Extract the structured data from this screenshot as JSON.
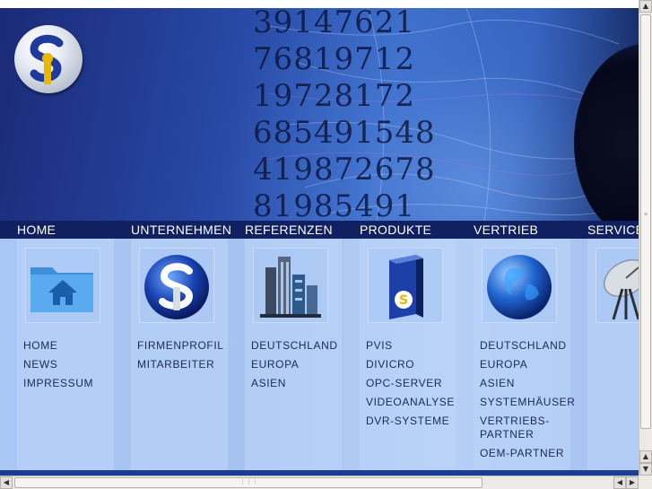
{
  "header": {
    "background_numbers": [
      "39147621",
      "76819712",
      "19728172",
      "685491548",
      "419872678",
      "81985491"
    ],
    "logo_icon": "s-logo-icon"
  },
  "nav": {
    "items": [
      {
        "label": "HOME"
      },
      {
        "label": "UNTERNEHMEN"
      },
      {
        "label": "REFERENZEN"
      },
      {
        "label": "PRODUKTE"
      },
      {
        "label": "VERTRIEB"
      },
      {
        "label": "SERVICE"
      }
    ]
  },
  "columns": [
    {
      "icon": "home-folder-icon",
      "items": [
        "HOME",
        "NEWS",
        "IMPRESSUM"
      ]
    },
    {
      "icon": "s-globe-logo-icon",
      "items": [
        "FIRMENPROFIL",
        "MITARBEITER"
      ]
    },
    {
      "icon": "office-buildings-icon",
      "items": [
        "DEUTSCHLAND",
        "EUROPA",
        "ASIEN"
      ]
    },
    {
      "icon": "software-box-icon",
      "items": [
        "PVIS",
        "DIVICRO",
        "OPC-SERVER",
        "VIDEOANALYSE",
        "DVR-SYSTEME"
      ]
    },
    {
      "icon": "earth-globe-icon",
      "items": [
        "DEUTSCHLAND",
        "EUROPA",
        "ASIEN",
        "SYSTEMHÄUSER",
        "VERTRIEBS-PARTNER",
        "OEM-PARTNER"
      ]
    },
    {
      "icon": "satellite-dish-icon",
      "items": []
    }
  ],
  "colors": {
    "nav_bg": "#102060",
    "content_bg": "#a9c7f4",
    "menu_text": "#1a2a55"
  }
}
